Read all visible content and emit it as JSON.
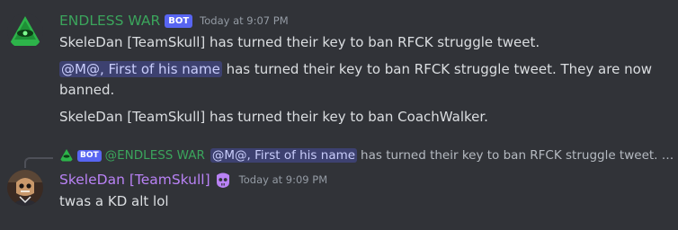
{
  "colors": {
    "background": "#313338",
    "bot_username": "#3ba55c",
    "user_username": "#b982f5",
    "bot_tag": "#5865f2",
    "mention_bg": "#3c4270",
    "mention_text": "#c9cdfb",
    "timestamp": "#949ba4",
    "text": "#dbdee1"
  },
  "messages": [
    {
      "author": "ENDLESS WAR",
      "bot_tag": "BOT",
      "timestamp": "Today at 9:07 PM",
      "avatar_icon": "green-pyramid-eye-icon",
      "lines": {
        "line1": "SkeleDan [TeamSkull] has turned their key to ban RFCK struggle tweet.",
        "line2_mention": "@M@, First of his name",
        "line2_text": " has turned their key to ban RFCK struggle tweet. They are now",
        "line2_cont": "banned.",
        "line3": "SkeleDan [TeamSkull] has turned their key to ban CoachWalker."
      }
    }
  ],
  "reply": {
    "bot_tag": "BOT",
    "author": "@ENDLESS WAR",
    "mention": "@M@, First of his name",
    "text": "has turned their key to ban RFCK struggle tweet. T..."
  },
  "message2": {
    "author": "SkeleDan [TeamSkull]",
    "role_icon": "skull-role-icon",
    "timestamp": "Today at 9:09 PM",
    "avatar_icon": "skeleton-avatar-icon",
    "content": "twas a KD alt lol"
  }
}
